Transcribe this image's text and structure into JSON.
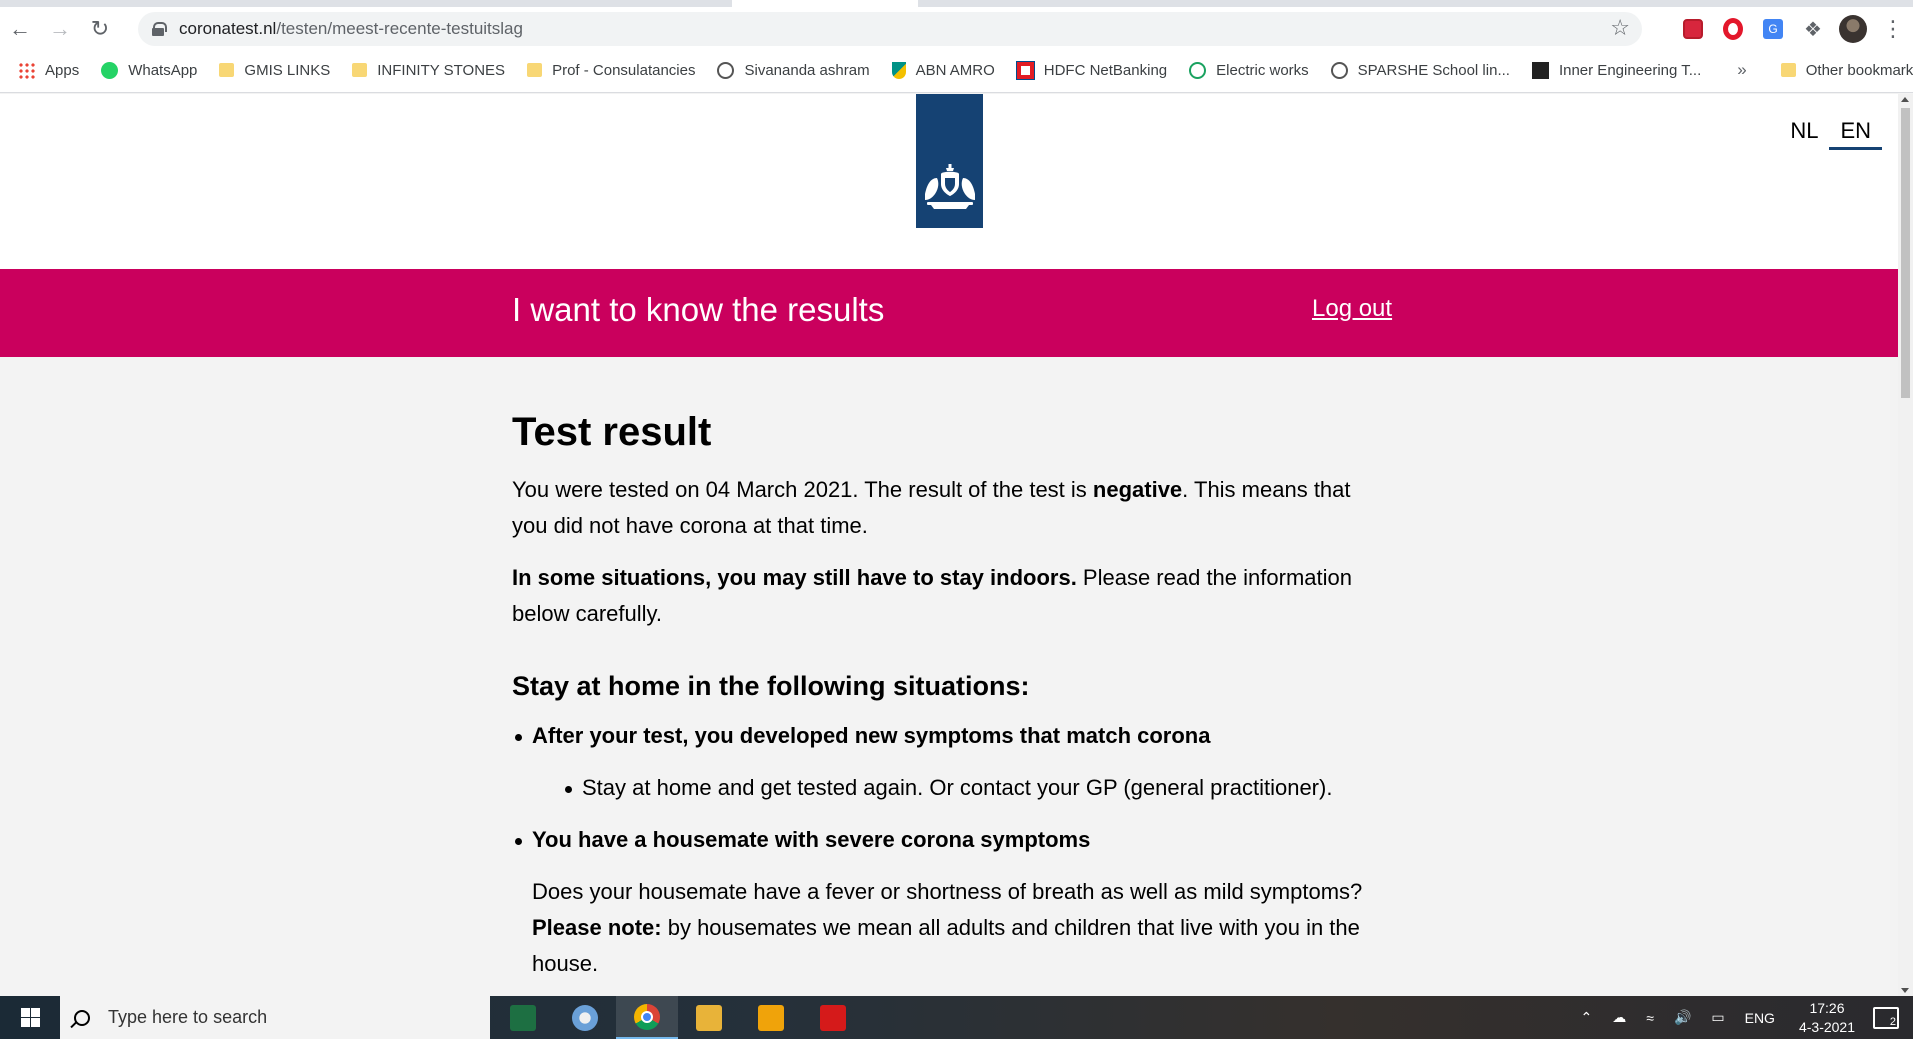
{
  "browser": {
    "url_host": "coronatest.nl",
    "url_path": "/testen/meest-recente-testuitslag",
    "bookmarks": [
      {
        "label": "Apps",
        "icon": "apps-icon"
      },
      {
        "label": "WhatsApp",
        "icon": "whatsapp-icon"
      },
      {
        "label": "GMIS LINKS",
        "icon": "folder-icon"
      },
      {
        "label": "INFINITY STONES",
        "icon": "folder-icon"
      },
      {
        "label": "Prof - Consulatancies",
        "icon": "folder-icon"
      },
      {
        "label": "Sivananda ashram",
        "icon": "site-icon"
      },
      {
        "label": "ABN AMRO",
        "icon": "abn-amro-icon"
      },
      {
        "label": "HDFC NetBanking",
        "icon": "hdfc-icon"
      },
      {
        "label": "Electric works",
        "icon": "check-icon"
      },
      {
        "label": "SPARSHE School lin...",
        "icon": "site-icon"
      },
      {
        "label": "Inner Engineering T...",
        "icon": "site-icon"
      }
    ],
    "bookmarks_more": "»",
    "other_bookmarks": "Other bookmarks"
  },
  "site": {
    "lang_nl": "NL",
    "lang_en": "EN",
    "banner_title": "I want to know the results",
    "logout": "Log out"
  },
  "content": {
    "title": "Test result",
    "p1_a": "You were tested on 04 March 2021. The result of the test is ",
    "p1_b": "negative",
    "p1_c": ". This means that you did not have corona at that time.",
    "p2_a": "In some situations, you may still have to stay indoors.",
    "p2_b": " Please read the information below carefully.",
    "h2": "Stay at home in the following situations:",
    "item1": "After your test, you developed new symptoms that match corona",
    "item1_sub": "Stay at home and get tested again. Or contact your GP (general practitioner).",
    "item2": "You have a housemate with severe corona symptoms",
    "item2_p_a": "Does your housemate have a fever or shortness of breath as well as mild symptoms? ",
    "item2_p_b": "Please note:",
    "item2_p_c": " by housemates we mean all adults and children that live with you in the house."
  },
  "taskbar": {
    "search_placeholder": "Type here to search",
    "lang": "ENG",
    "time": "17:26",
    "date": "4-3-2021",
    "notifications": "2"
  },
  "colors": {
    "banner": "#ca005d",
    "logo_band": "#154273"
  }
}
